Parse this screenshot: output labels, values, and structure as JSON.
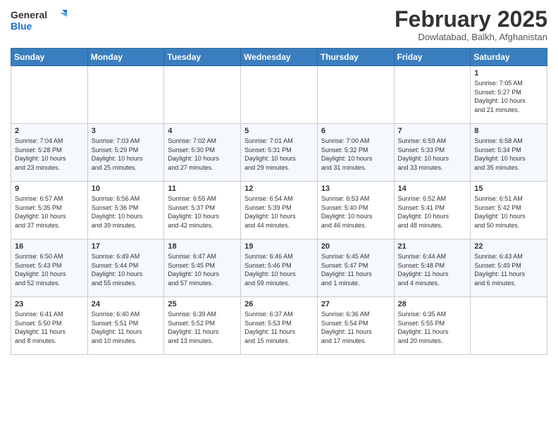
{
  "header": {
    "logo_general": "General",
    "logo_blue": "Blue",
    "month_title": "February 2025",
    "location": "Dowlatabad, Balkh, Afghanistan"
  },
  "days_of_week": [
    "Sunday",
    "Monday",
    "Tuesday",
    "Wednesday",
    "Thursday",
    "Friday",
    "Saturday"
  ],
  "weeks": [
    [
      {
        "day": "",
        "info": ""
      },
      {
        "day": "",
        "info": ""
      },
      {
        "day": "",
        "info": ""
      },
      {
        "day": "",
        "info": ""
      },
      {
        "day": "",
        "info": ""
      },
      {
        "day": "",
        "info": ""
      },
      {
        "day": "1",
        "info": "Sunrise: 7:05 AM\nSunset: 5:27 PM\nDaylight: 10 hours\nand 21 minutes."
      }
    ],
    [
      {
        "day": "2",
        "info": "Sunrise: 7:04 AM\nSunset: 5:28 PM\nDaylight: 10 hours\nand 23 minutes."
      },
      {
        "day": "3",
        "info": "Sunrise: 7:03 AM\nSunset: 5:29 PM\nDaylight: 10 hours\nand 25 minutes."
      },
      {
        "day": "4",
        "info": "Sunrise: 7:02 AM\nSunset: 5:30 PM\nDaylight: 10 hours\nand 27 minutes."
      },
      {
        "day": "5",
        "info": "Sunrise: 7:01 AM\nSunset: 5:31 PM\nDaylight: 10 hours\nand 29 minutes."
      },
      {
        "day": "6",
        "info": "Sunrise: 7:00 AM\nSunset: 5:32 PM\nDaylight: 10 hours\nand 31 minutes."
      },
      {
        "day": "7",
        "info": "Sunrise: 6:59 AM\nSunset: 5:33 PM\nDaylight: 10 hours\nand 33 minutes."
      },
      {
        "day": "8",
        "info": "Sunrise: 6:58 AM\nSunset: 5:34 PM\nDaylight: 10 hours\nand 35 minutes."
      }
    ],
    [
      {
        "day": "9",
        "info": "Sunrise: 6:57 AM\nSunset: 5:35 PM\nDaylight: 10 hours\nand 37 minutes."
      },
      {
        "day": "10",
        "info": "Sunrise: 6:56 AM\nSunset: 5:36 PM\nDaylight: 10 hours\nand 39 minutes."
      },
      {
        "day": "11",
        "info": "Sunrise: 6:55 AM\nSunset: 5:37 PM\nDaylight: 10 hours\nand 42 minutes."
      },
      {
        "day": "12",
        "info": "Sunrise: 6:54 AM\nSunset: 5:39 PM\nDaylight: 10 hours\nand 44 minutes."
      },
      {
        "day": "13",
        "info": "Sunrise: 6:53 AM\nSunset: 5:40 PM\nDaylight: 10 hours\nand 46 minutes."
      },
      {
        "day": "14",
        "info": "Sunrise: 6:52 AM\nSunset: 5:41 PM\nDaylight: 10 hours\nand 48 minutes."
      },
      {
        "day": "15",
        "info": "Sunrise: 6:51 AM\nSunset: 5:42 PM\nDaylight: 10 hours\nand 50 minutes."
      }
    ],
    [
      {
        "day": "16",
        "info": "Sunrise: 6:50 AM\nSunset: 5:43 PM\nDaylight: 10 hours\nand 52 minutes."
      },
      {
        "day": "17",
        "info": "Sunrise: 6:49 AM\nSunset: 5:44 PM\nDaylight: 10 hours\nand 55 minutes."
      },
      {
        "day": "18",
        "info": "Sunrise: 6:47 AM\nSunset: 5:45 PM\nDaylight: 10 hours\nand 57 minutes."
      },
      {
        "day": "19",
        "info": "Sunrise: 6:46 AM\nSunset: 5:46 PM\nDaylight: 10 hours\nand 59 minutes."
      },
      {
        "day": "20",
        "info": "Sunrise: 6:45 AM\nSunset: 5:47 PM\nDaylight: 11 hours\nand 1 minute."
      },
      {
        "day": "21",
        "info": "Sunrise: 6:44 AM\nSunset: 5:48 PM\nDaylight: 11 hours\nand 4 minutes."
      },
      {
        "day": "22",
        "info": "Sunrise: 6:43 AM\nSunset: 5:49 PM\nDaylight: 11 hours\nand 6 minutes."
      }
    ],
    [
      {
        "day": "23",
        "info": "Sunrise: 6:41 AM\nSunset: 5:50 PM\nDaylight: 11 hours\nand 8 minutes."
      },
      {
        "day": "24",
        "info": "Sunrise: 6:40 AM\nSunset: 5:51 PM\nDaylight: 11 hours\nand 10 minutes."
      },
      {
        "day": "25",
        "info": "Sunrise: 6:39 AM\nSunset: 5:52 PM\nDaylight: 11 hours\nand 13 minutes."
      },
      {
        "day": "26",
        "info": "Sunrise: 6:37 AM\nSunset: 5:53 PM\nDaylight: 11 hours\nand 15 minutes."
      },
      {
        "day": "27",
        "info": "Sunrise: 6:36 AM\nSunset: 5:54 PM\nDaylight: 11 hours\nand 17 minutes."
      },
      {
        "day": "28",
        "info": "Sunrise: 6:35 AM\nSunset: 5:55 PM\nDaylight: 11 hours\nand 20 minutes."
      },
      {
        "day": "",
        "info": ""
      }
    ]
  ]
}
